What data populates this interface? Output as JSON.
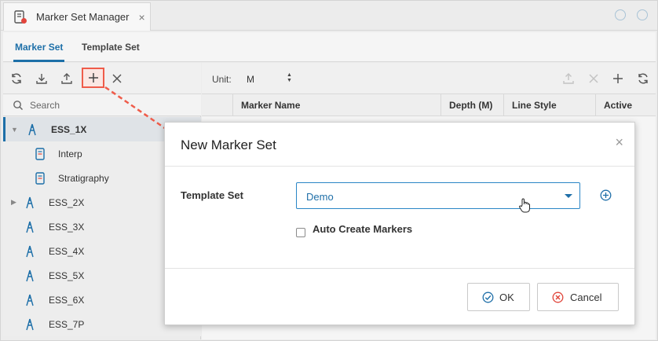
{
  "window": {
    "tab_title": "Marker Set Manager",
    "tab_close": "×"
  },
  "section_tabs": [
    {
      "label": "Marker Set",
      "active": true
    },
    {
      "label": "Template Set",
      "active": false
    }
  ],
  "left_panel": {
    "search_placeholder": "Search",
    "tree": [
      {
        "label": "ESS_1X",
        "level": 0,
        "expanded": true,
        "selected": true,
        "icon": "well-icon"
      },
      {
        "label": "Interp",
        "level": 1,
        "icon": "marker-set-icon"
      },
      {
        "label": "Stratigraphy",
        "level": 1,
        "icon": "marker-set-icon"
      },
      {
        "label": "ESS_2X",
        "level": 0,
        "expanded": false,
        "icon": "well-icon"
      },
      {
        "label": "ESS_3X",
        "level": 0,
        "icon": "well-icon"
      },
      {
        "label": "ESS_4X",
        "level": 0,
        "icon": "well-icon"
      },
      {
        "label": "ESS_5X",
        "level": 0,
        "icon": "well-icon"
      },
      {
        "label": "ESS_6X",
        "level": 0,
        "icon": "well-icon"
      },
      {
        "label": "ESS_7P",
        "level": 0,
        "icon": "well-icon"
      }
    ]
  },
  "right_panel": {
    "unit_label": "Unit:",
    "unit_value": "M",
    "columns": [
      "Marker Name",
      "Depth (M)",
      "Line Style",
      "Active"
    ]
  },
  "dialog": {
    "title": "New Marker Set",
    "close": "×",
    "template_label": "Template Set",
    "template_value": "Demo",
    "auto_create_label": "Auto Create Markers",
    "auto_create_checked": false,
    "ok_label": "OK",
    "cancel_label": "Cancel"
  },
  "colors": {
    "accent": "#1d6fa8",
    "highlight": "#ef5c4a",
    "cancel": "#e0453a"
  }
}
